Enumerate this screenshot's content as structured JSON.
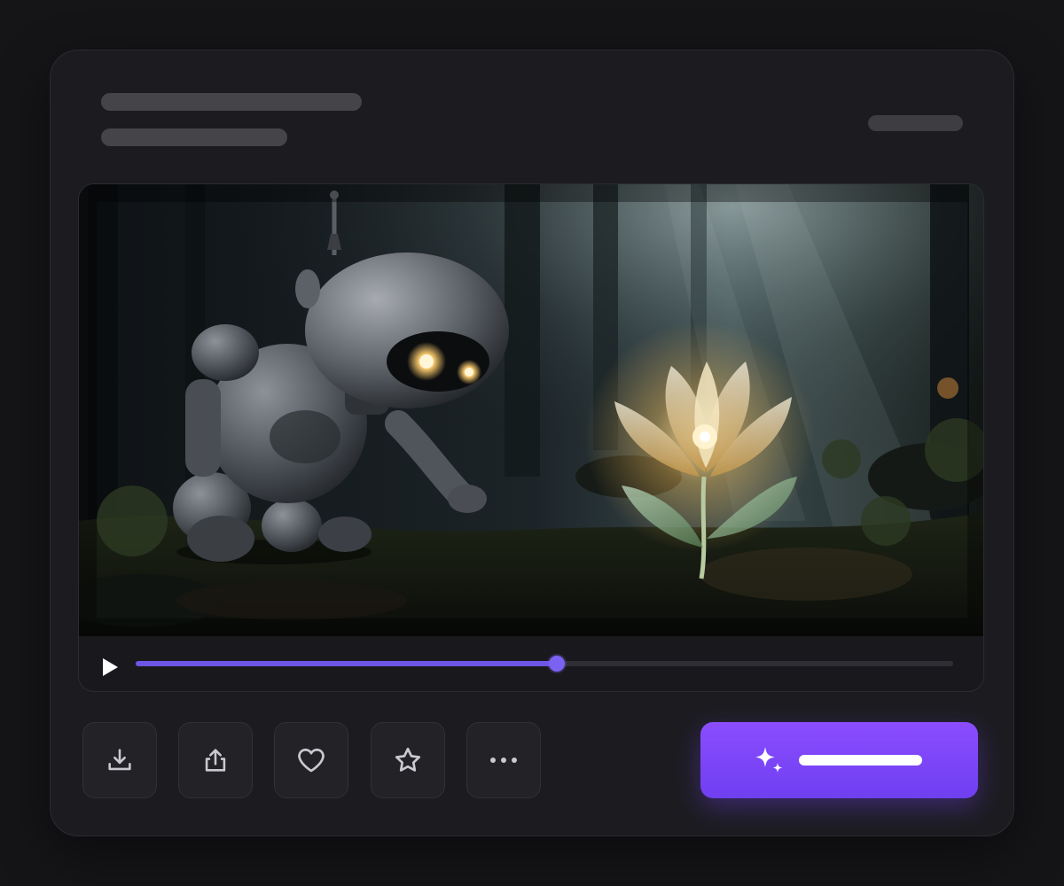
{
  "header": {
    "title_placeholder": "skeleton-line",
    "subtitle_placeholder": "skeleton-line",
    "meta_placeholder": "skeleton-line"
  },
  "player": {
    "media": "robot-and-glowing-flower-forest-scene",
    "play_icon": "play-icon",
    "progress": 0.515,
    "accent_color": "#6e55e3"
  },
  "actions": [
    {
      "name": "download-button",
      "icon": "download-icon"
    },
    {
      "name": "share-button",
      "icon": "share-icon"
    },
    {
      "name": "like-button",
      "icon": "heart-icon"
    },
    {
      "name": "favorite-button",
      "icon": "star-icon"
    },
    {
      "name": "more-button",
      "icon": "more-horizontal-icon"
    }
  ],
  "primary_action": {
    "icon": "sparkles-icon",
    "label_placeholder": "skeleton-line",
    "color_start": "#8a4dff",
    "color_end": "#6f3ff0"
  },
  "colors": {
    "background": "#151518",
    "card": "#1c1c20",
    "skeleton": "#444449",
    "icon": "#c9c9cf"
  }
}
